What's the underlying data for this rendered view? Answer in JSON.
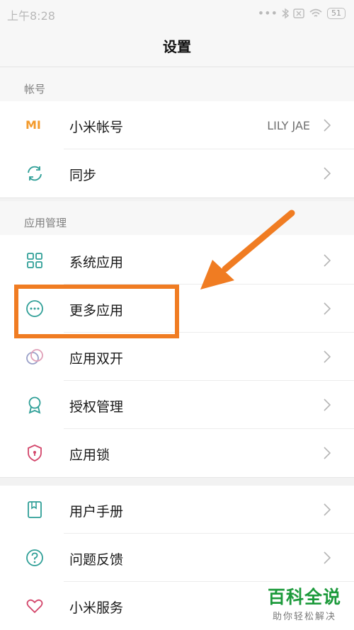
{
  "status": {
    "time": "上午8:28",
    "battery": "51"
  },
  "title": "设置",
  "sections": [
    {
      "header": "帐号"
    },
    {
      "header": "应用管理"
    }
  ],
  "rows": {
    "mi_account": {
      "label": "小米帐号",
      "value": "LILY JAE"
    },
    "sync": {
      "label": "同步"
    },
    "system_apps": {
      "label": "系统应用"
    },
    "more_apps": {
      "label": "更多应用"
    },
    "dual_apps": {
      "label": "应用双开"
    },
    "permissions": {
      "label": "授权管理"
    },
    "app_lock": {
      "label": "应用锁"
    },
    "user_manual": {
      "label": "用户手册"
    },
    "feedback": {
      "label": "问题反馈"
    },
    "mi_services": {
      "label": "小米服务"
    }
  },
  "mi_logo_text": "MI",
  "watermark": {
    "title": "百科全说",
    "subtitle": "助你轻松解决"
  },
  "colors": {
    "accent": "#f07c22",
    "teal": "#2f9f97",
    "pink": "#d3456a",
    "mi_orange": "#f39a2c",
    "watermark_green": "#1c9a3b"
  }
}
